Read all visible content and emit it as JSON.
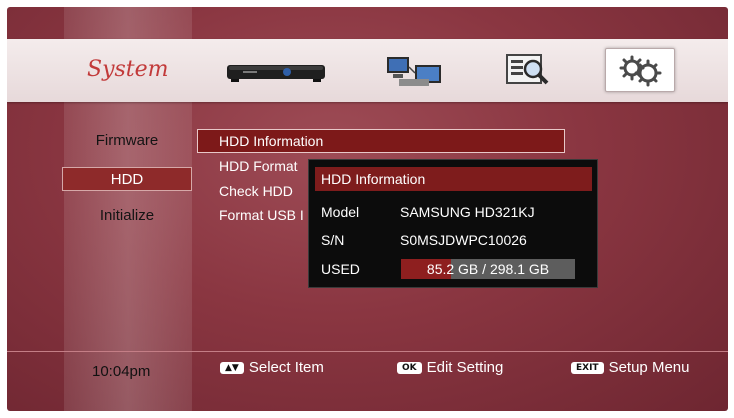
{
  "header": {
    "title": "System",
    "icons": [
      "set-top-box-icon",
      "network-icon",
      "media-info-icon",
      "settings-gears-icon"
    ]
  },
  "sidebar": {
    "items": [
      {
        "label": "Firmware",
        "selected": false
      },
      {
        "label": "HDD",
        "selected": true
      },
      {
        "label": "Initialize",
        "selected": false
      }
    ]
  },
  "menu": {
    "items": [
      {
        "label": "HDD Information",
        "selected": true
      },
      {
        "label": "HDD Format"
      },
      {
        "label": "Check HDD"
      },
      {
        "label": "Format USB I"
      }
    ]
  },
  "hdd_popup": {
    "title": "HDD Information",
    "model_label": "Model",
    "model_value": "SAMSUNG HD321KJ",
    "sn_label": "S/N",
    "sn_value": "S0MSJDWPC10026",
    "used_label": "USED",
    "used_value": "85.2 GB / 298.1 GB",
    "used_fraction": 0.286
  },
  "footer": {
    "time": "10:04pm",
    "hints": [
      {
        "key": "▲▼",
        "label": "Select Item"
      },
      {
        "key": "OK",
        "label": "Edit Setting"
      },
      {
        "key": "EXIT",
        "label": "Setup Menu"
      }
    ]
  },
  "colors": {
    "background": "#8a3641",
    "accent": "#7e1c1c",
    "title_red": "#c23a3a"
  }
}
